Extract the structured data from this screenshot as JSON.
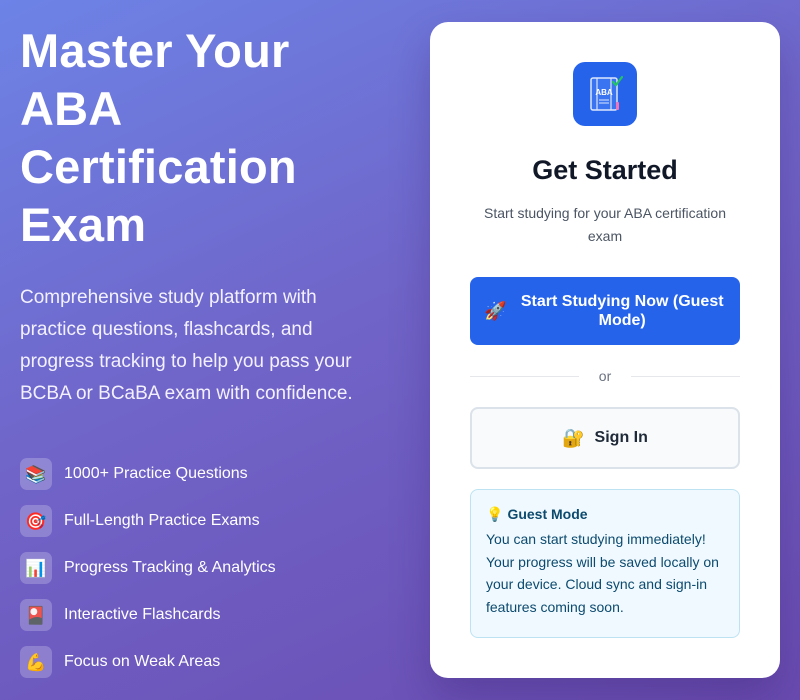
{
  "hero": {
    "title": "Master Your ABA Certification Exam",
    "subtitle": "Comprehensive study platform with practice questions, flashcards, and progress tracking to help you pass your BCBA or BCaBA exam with confidence."
  },
  "features": [
    {
      "icon": "📚",
      "icon_name": "books-icon",
      "label": "1000+ Practice Questions"
    },
    {
      "icon": "🎯",
      "icon_name": "target-icon",
      "label": "Full-Length Practice Exams"
    },
    {
      "icon": "📊",
      "icon_name": "bar-chart-icon",
      "label": "Progress Tracking & Analytics"
    },
    {
      "icon": "🎴",
      "icon_name": "flashcards-icon",
      "label": "Interactive Flashcards"
    },
    {
      "icon": "💪",
      "icon_name": "flexed-bicep-icon",
      "label": "Focus on Weak Areas"
    }
  ],
  "card": {
    "logo_text": "ABA",
    "title": "Get Started",
    "subtitle": "Start studying for your ABA certification exam",
    "primary_button": {
      "icon": "🚀",
      "label": "Start Studying Now (Guest Mode)"
    },
    "divider_label": "or",
    "secondary_button": {
      "icon": "🔐",
      "label": "Sign In"
    },
    "guest_note": {
      "icon": "💡",
      "title": "Guest Mode",
      "body": "You can start studying immediately! Your progress will be saved locally on your device. Cloud sync and sign-in features coming soon."
    }
  },
  "colors": {
    "background_start": "#6d83e6",
    "background_end": "#6a4bb0",
    "primary": "#2563eb",
    "note_bg": "#f0f9ff",
    "note_text": "#0c4a6e"
  }
}
